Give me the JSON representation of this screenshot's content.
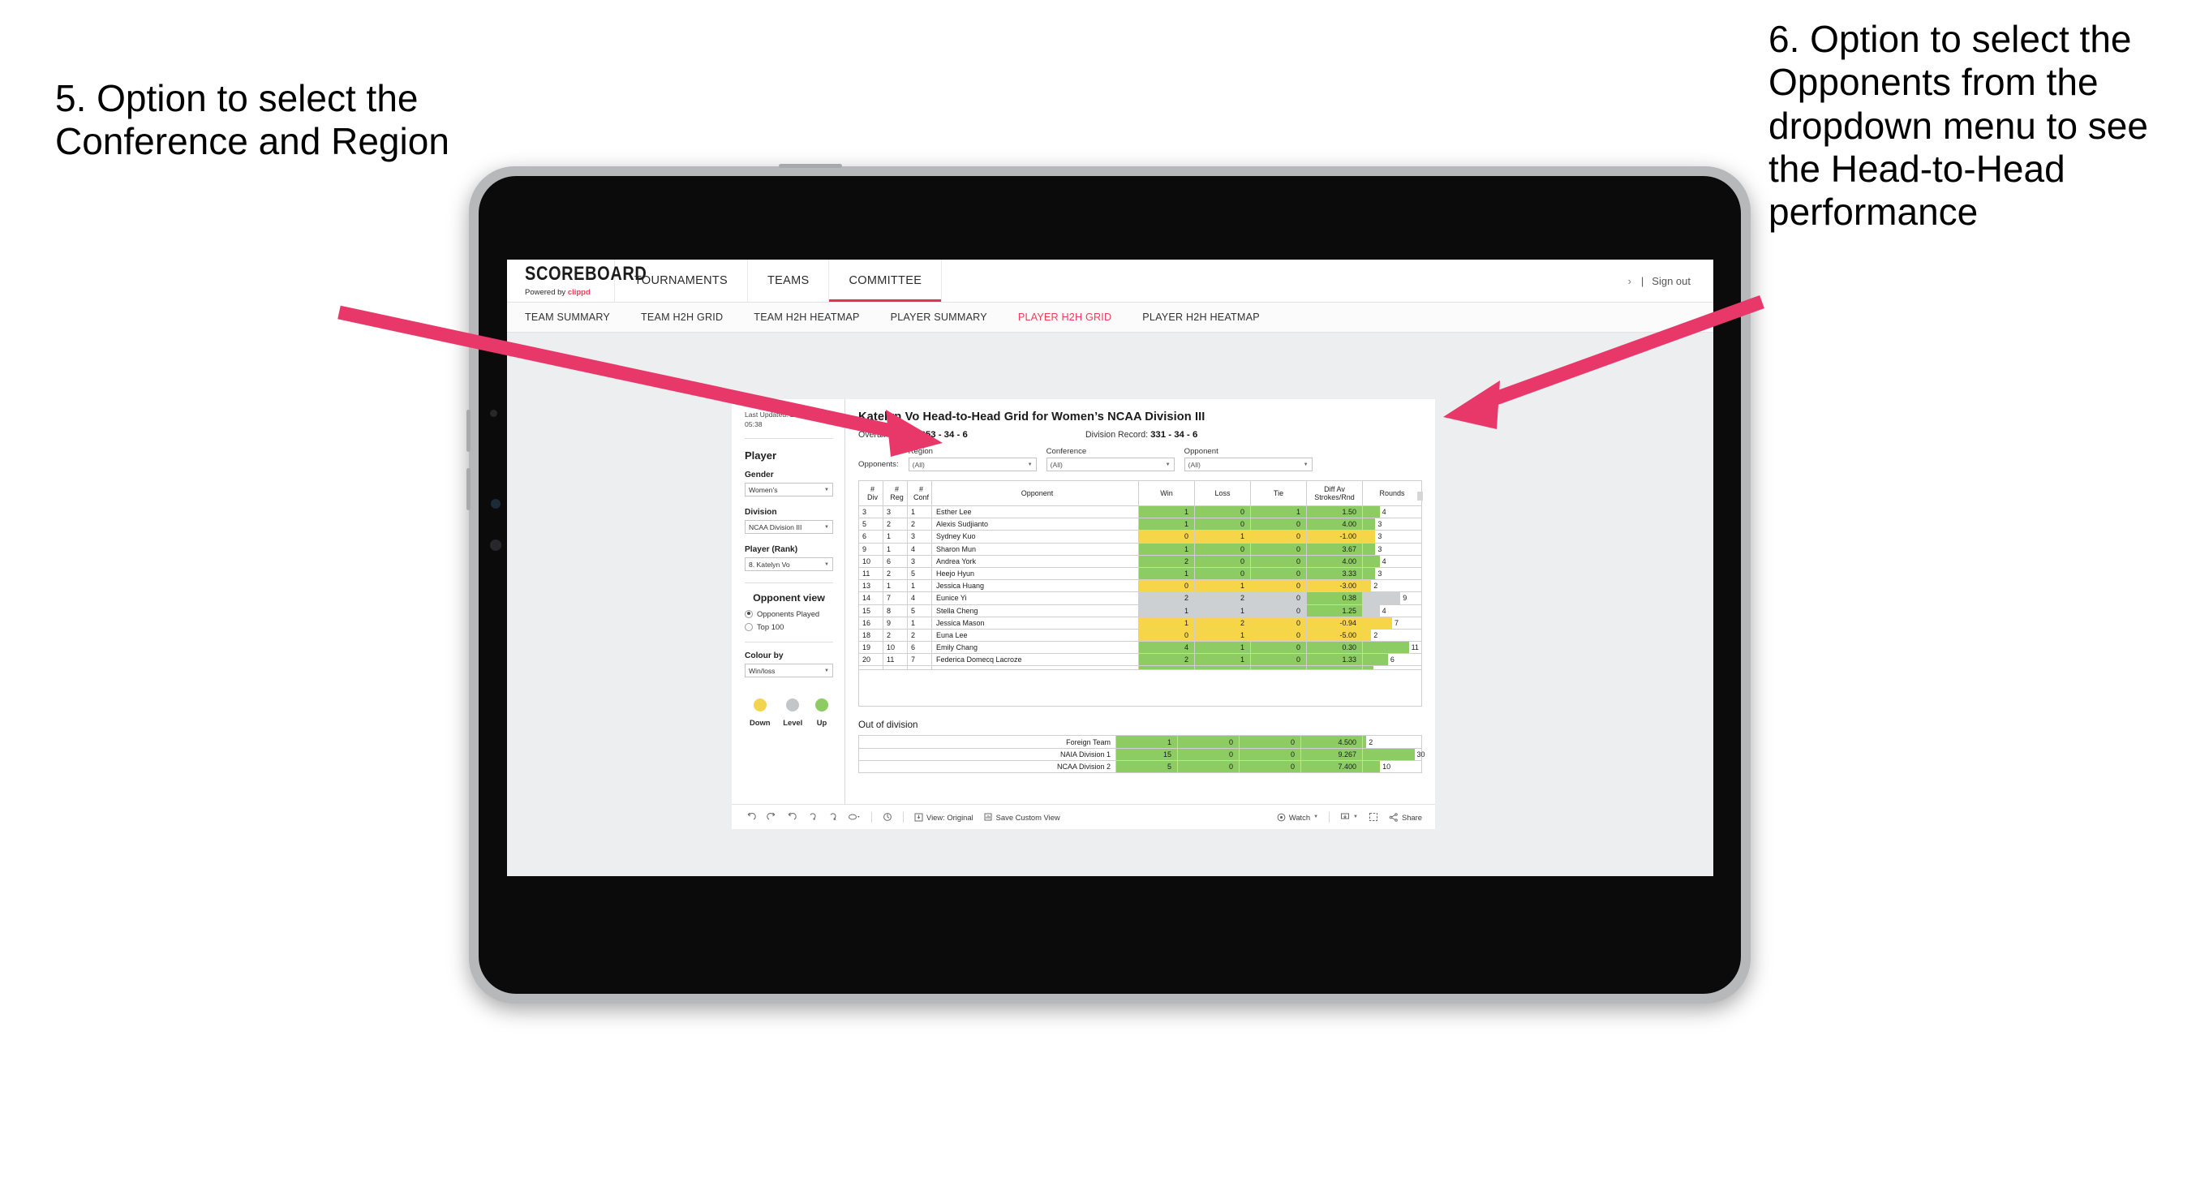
{
  "annotations": {
    "left": "5. Option to select the Conference and Region",
    "right": "6. Option to select the Opponents from the dropdown menu to see the Head-to-Head performance",
    "arrow_color": "#e8386a"
  },
  "browser": {
    "logo": {
      "main": "SCOREBOARD",
      "powered_prefix": "Powered by ",
      "brand": "clippd"
    },
    "top_nav": [
      {
        "label": "TOURNAMENTS",
        "active": false
      },
      {
        "label": "TEAMS",
        "active": false
      },
      {
        "label": "COMMITTEE",
        "active": true
      }
    ],
    "account": {
      "dots": "›",
      "divider": "|",
      "sign_out": "Sign out"
    },
    "sub_nav": [
      {
        "label": "TEAM SUMMARY",
        "active": false
      },
      {
        "label": "TEAM H2H GRID",
        "active": false
      },
      {
        "label": "TEAM H2H HEATMAP",
        "active": false
      },
      {
        "label": "PLAYER SUMMARY",
        "active": false
      },
      {
        "label": "PLAYER H2H GRID",
        "active": true
      },
      {
        "label": "PLAYER H2H HEATMAP",
        "active": false
      }
    ]
  },
  "sidebar": {
    "last_updated": "Last Updated: 27/03/2024 05:38",
    "section_player": "Player",
    "gender": {
      "label": "Gender",
      "value": "Women’s"
    },
    "division": {
      "label": "Division",
      "value": "NCAA Division III"
    },
    "player_rank": {
      "label": "Player (Rank)",
      "value": "8. Katelyn Vo"
    },
    "opponent_view": {
      "title": "Opponent view",
      "options": [
        {
          "label": "Opponents Played",
          "selected": true
        },
        {
          "label": "Top 100",
          "selected": false
        }
      ]
    },
    "colour_by": {
      "label": "Colour by",
      "value": "Win/loss"
    },
    "legend": [
      {
        "label": "Down",
        "color": "#f2d44f"
      },
      {
        "label": "Level",
        "color": "#c3c6c9"
      },
      {
        "label": "Up",
        "color": "#8ccc63"
      }
    ]
  },
  "viz": {
    "title": "Katelyn Vo Head-to-Head Grid for Women’s NCAA Division III",
    "overall_record_label": "Overall Record:",
    "overall_record_value": "353 - 34 - 6",
    "division_record_label": "Division Record:",
    "division_record_value": "331 - 34 - 6",
    "filters": {
      "lead_label": "Opponents:",
      "items": [
        {
          "label": "Region",
          "value": "(All)"
        },
        {
          "label": "Conference",
          "value": "(All)"
        },
        {
          "label": "Opponent",
          "value": "(All)"
        }
      ]
    },
    "table": {
      "headers": [
        "# Div",
        "# Reg",
        "# Conf",
        "Opponent",
        "Win",
        "Loss",
        "Tie",
        "Diff Av Strokes/Rnd",
        "Rounds"
      ],
      "header_lines": [
        [
          "#",
          "Div"
        ],
        [
          "#",
          "Reg"
        ],
        [
          "#",
          "Conf"
        ],
        [
          "Opponent",
          ""
        ],
        [
          "Win",
          ""
        ],
        [
          "Loss",
          ""
        ],
        [
          "Tie",
          ""
        ],
        [
          "Diff Av",
          "Strokes/Rnd"
        ],
        [
          "Rounds",
          ""
        ]
      ],
      "rows": [
        {
          "div": "3",
          "reg": "3",
          "conf": "1",
          "opponent": "Esther Lee",
          "win": "1",
          "loss": "0",
          "tie": "1",
          "diff": "1.50",
          "rounds": "4",
          "color": "g",
          "diff_color": "g"
        },
        {
          "div": "5",
          "reg": "2",
          "conf": "2",
          "opponent": "Alexis Sudjianto",
          "win": "1",
          "loss": "0",
          "tie": "0",
          "diff": "4.00",
          "rounds": "3",
          "color": "g",
          "diff_color": "g"
        },
        {
          "div": "6",
          "reg": "1",
          "conf": "3",
          "opponent": "Sydney Kuo",
          "win": "0",
          "loss": "1",
          "tie": "0",
          "diff": "-1.00",
          "rounds": "3",
          "color": "y",
          "diff_color": "y"
        },
        {
          "div": "9",
          "reg": "1",
          "conf": "4",
          "opponent": "Sharon Mun",
          "win": "1",
          "loss": "0",
          "tie": "0",
          "diff": "3.67",
          "rounds": "3",
          "color": "g",
          "diff_color": "g"
        },
        {
          "div": "10",
          "reg": "6",
          "conf": "3",
          "opponent": "Andrea York",
          "win": "2",
          "loss": "0",
          "tie": "0",
          "diff": "4.00",
          "rounds": "4",
          "color": "g",
          "diff_color": "g"
        },
        {
          "div": "11",
          "reg": "2",
          "conf": "5",
          "opponent": "Heejo Hyun",
          "win": "1",
          "loss": "0",
          "tie": "0",
          "diff": "3.33",
          "rounds": "3",
          "color": "g",
          "diff_color": "g"
        },
        {
          "div": "13",
          "reg": "1",
          "conf": "1",
          "opponent": "Jessica Huang",
          "win": "0",
          "loss": "1",
          "tie": "0",
          "diff": "-3.00",
          "rounds": "2",
          "color": "y",
          "diff_color": "y"
        },
        {
          "div": "14",
          "reg": "7",
          "conf": "4",
          "opponent": "Eunice Yi",
          "win": "2",
          "loss": "2",
          "tie": "0",
          "diff": "0.38",
          "rounds": "9",
          "color": "gr",
          "diff_color": "g"
        },
        {
          "div": "15",
          "reg": "8",
          "conf": "5",
          "opponent": "Stella Cheng",
          "win": "1",
          "loss": "1",
          "tie": "0",
          "diff": "1.25",
          "rounds": "4",
          "color": "gr",
          "diff_color": "g"
        },
        {
          "div": "16",
          "reg": "9",
          "conf": "1",
          "opponent": "Jessica Mason",
          "win": "1",
          "loss": "2",
          "tie": "0",
          "diff": "-0.94",
          "rounds": "7",
          "color": "y",
          "diff_color": "y"
        },
        {
          "div": "18",
          "reg": "2",
          "conf": "2",
          "opponent": "Euna Lee",
          "win": "0",
          "loss": "1",
          "tie": "0",
          "diff": "-5.00",
          "rounds": "2",
          "color": "y",
          "diff_color": "y"
        },
        {
          "div": "19",
          "reg": "10",
          "conf": "6",
          "opponent": "Emily Chang",
          "win": "4",
          "loss": "1",
          "tie": "0",
          "diff": "0.30",
          "rounds": "11",
          "color": "g",
          "diff_color": "g"
        },
        {
          "div": "20",
          "reg": "11",
          "conf": "7",
          "opponent": "Federica Domecq Lacroze",
          "win": "2",
          "loss": "1",
          "tie": "0",
          "diff": "1.33",
          "rounds": "6",
          "color": "g",
          "diff_color": "g"
        }
      ],
      "max_rounds": 14
    },
    "out_of_division": {
      "title": "Out of division",
      "rows": [
        {
          "name": "Foreign Team",
          "win": "1",
          "loss": "0",
          "tie": "0",
          "diff": "4.500",
          "rounds": "2",
          "color": "g"
        },
        {
          "name": "NAIA Division 1",
          "win": "15",
          "loss": "0",
          "tie": "0",
          "diff": "9.267",
          "rounds": "30",
          "color": "g"
        },
        {
          "name": "NCAA Division 2",
          "win": "5",
          "loss": "0",
          "tie": "0",
          "diff": "7.400",
          "rounds": "10",
          "color": "g"
        }
      ],
      "max_rounds": 34
    }
  },
  "toolbar": {
    "icons": [
      "undo-icon",
      "redo-icon",
      "revert-icon",
      "refresh-icon",
      "pause-icon",
      "highlight-icon"
    ],
    "view_original": "View: Original",
    "save_custom_view": "Save Custom View",
    "watch": "Watch",
    "share": "Share"
  }
}
